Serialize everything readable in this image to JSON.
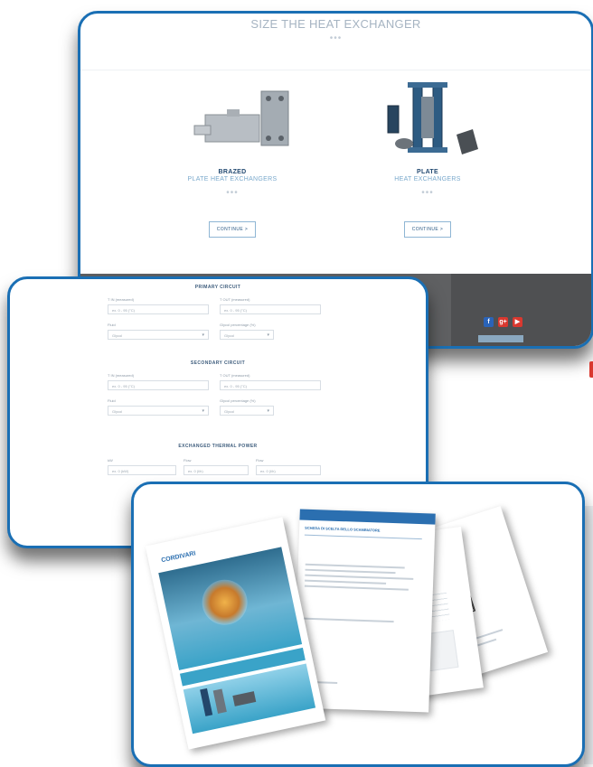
{
  "top_panel": {
    "title": "SIZE THE HEAT EXCHANGER",
    "title_dots": "•••",
    "products": [
      {
        "name": "BRAZED",
        "subtitle": "PLATE HEAT EXCHANGERS",
        "dots": "•••",
        "button": "CONTINUE  >"
      },
      {
        "name": "PLATE",
        "subtitle": "HEAT EXCHANGERS",
        "dots": "•••",
        "button": "CONTINUE  >"
      }
    ],
    "social": {
      "facebook": "f",
      "googleplus": "g+",
      "youtube": "▶"
    },
    "social_colors": {
      "facebook": "#2a63b8",
      "googleplus": "#d9382f",
      "youtube": "#d9382f"
    }
  },
  "form_panel": {
    "primary_title": "PRIMARY CIRCUIT",
    "secondary_title": "SECONDARY CIRCUIT",
    "thermal_title": "EXCHANGED THERMAL POWER",
    "primary": {
      "inlet_label": "T IN (measured)",
      "outlet_label": "T OUT (measured)",
      "inlet_value": "ex. 0 - 95 (°C)",
      "outlet_value": "ex. 0 - 95 (°C)",
      "fluid_label": "Fluid",
      "fluid_value": "Glycol",
      "glycol_label": "Glycol percentage (%)",
      "glycol_value": "Glycol"
    },
    "secondary": {
      "inlet_label": "T IN (measured)",
      "outlet_label": "T OUT (measured)",
      "inlet_value": "ex. 0 - 95 (°C)",
      "outlet_value": "ex. 0 - 95 (°C)",
      "fluid_label": "Fluid",
      "fluid_value": "Glycol",
      "glycol_label": "Glycol percentage (%)",
      "glycol_value": "Glycol"
    },
    "thermal": {
      "kw_label": "kW",
      "flow_label": "Flow",
      "flow2_label": "Flow",
      "kw_value": "ex. 0 (kW)",
      "flow_value": "ex. 0 (l/h)",
      "flow2_value": "ex. 0 (l/h)"
    }
  },
  "docs_panel": {
    "brand": "CORDIVARI",
    "doc_header": "SCHEDA DI SCELTA DELLO SCAMBIATORE"
  }
}
